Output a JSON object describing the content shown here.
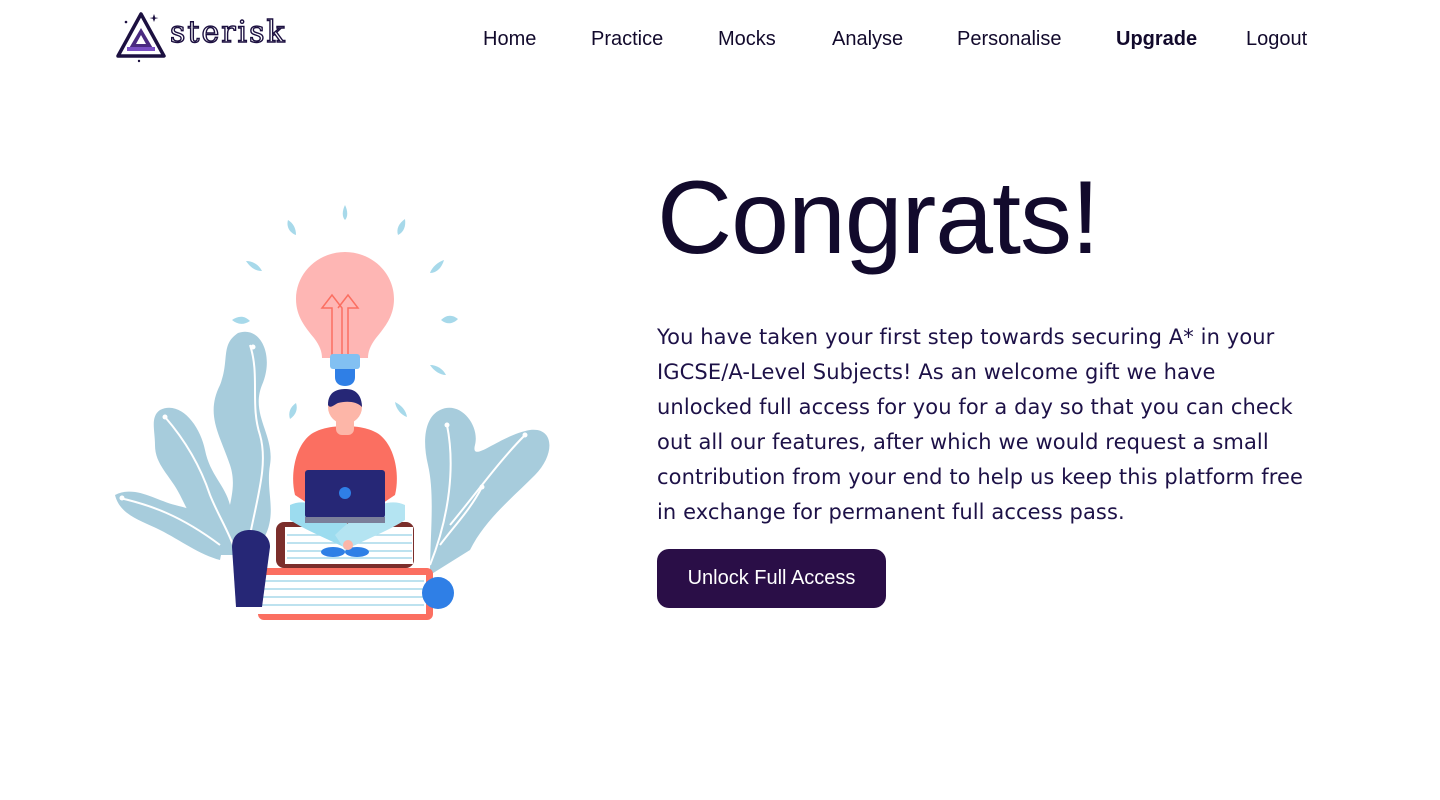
{
  "brand": {
    "logo_text": "sterisk",
    "accent": "#2a0e47",
    "text_color": "#120a2c"
  },
  "nav": {
    "items": [
      {
        "label": "Home"
      },
      {
        "label": "Practice"
      },
      {
        "label": "Mocks"
      },
      {
        "label": "Analyse"
      },
      {
        "label": "Personalise"
      },
      {
        "label": "Upgrade",
        "active": true
      },
      {
        "label": "Logout"
      }
    ]
  },
  "main": {
    "title": "Congrats!",
    "message": "You have taken your first step towards securing A* in your IGCSE/A-Level Subjects! As an welcome gift we have unlocked full access for you for a day so that you can check out all our features, after which we would request a small contribution from your end to help us keep this platform free in exchange for permanent full access pass.",
    "cta_label": "Unlock Full Access"
  },
  "illustration": {
    "icon": "student-with-lightbulb-illustration",
    "colors": {
      "leaf": "#a7ccdc",
      "bulb": "#feb6b4",
      "shirt": "#fb6f61",
      "laptop": "#262776",
      "book_red": "#fb6f61",
      "book_brown": "#7b2e2b",
      "blue": "#2f7fe6"
    }
  }
}
